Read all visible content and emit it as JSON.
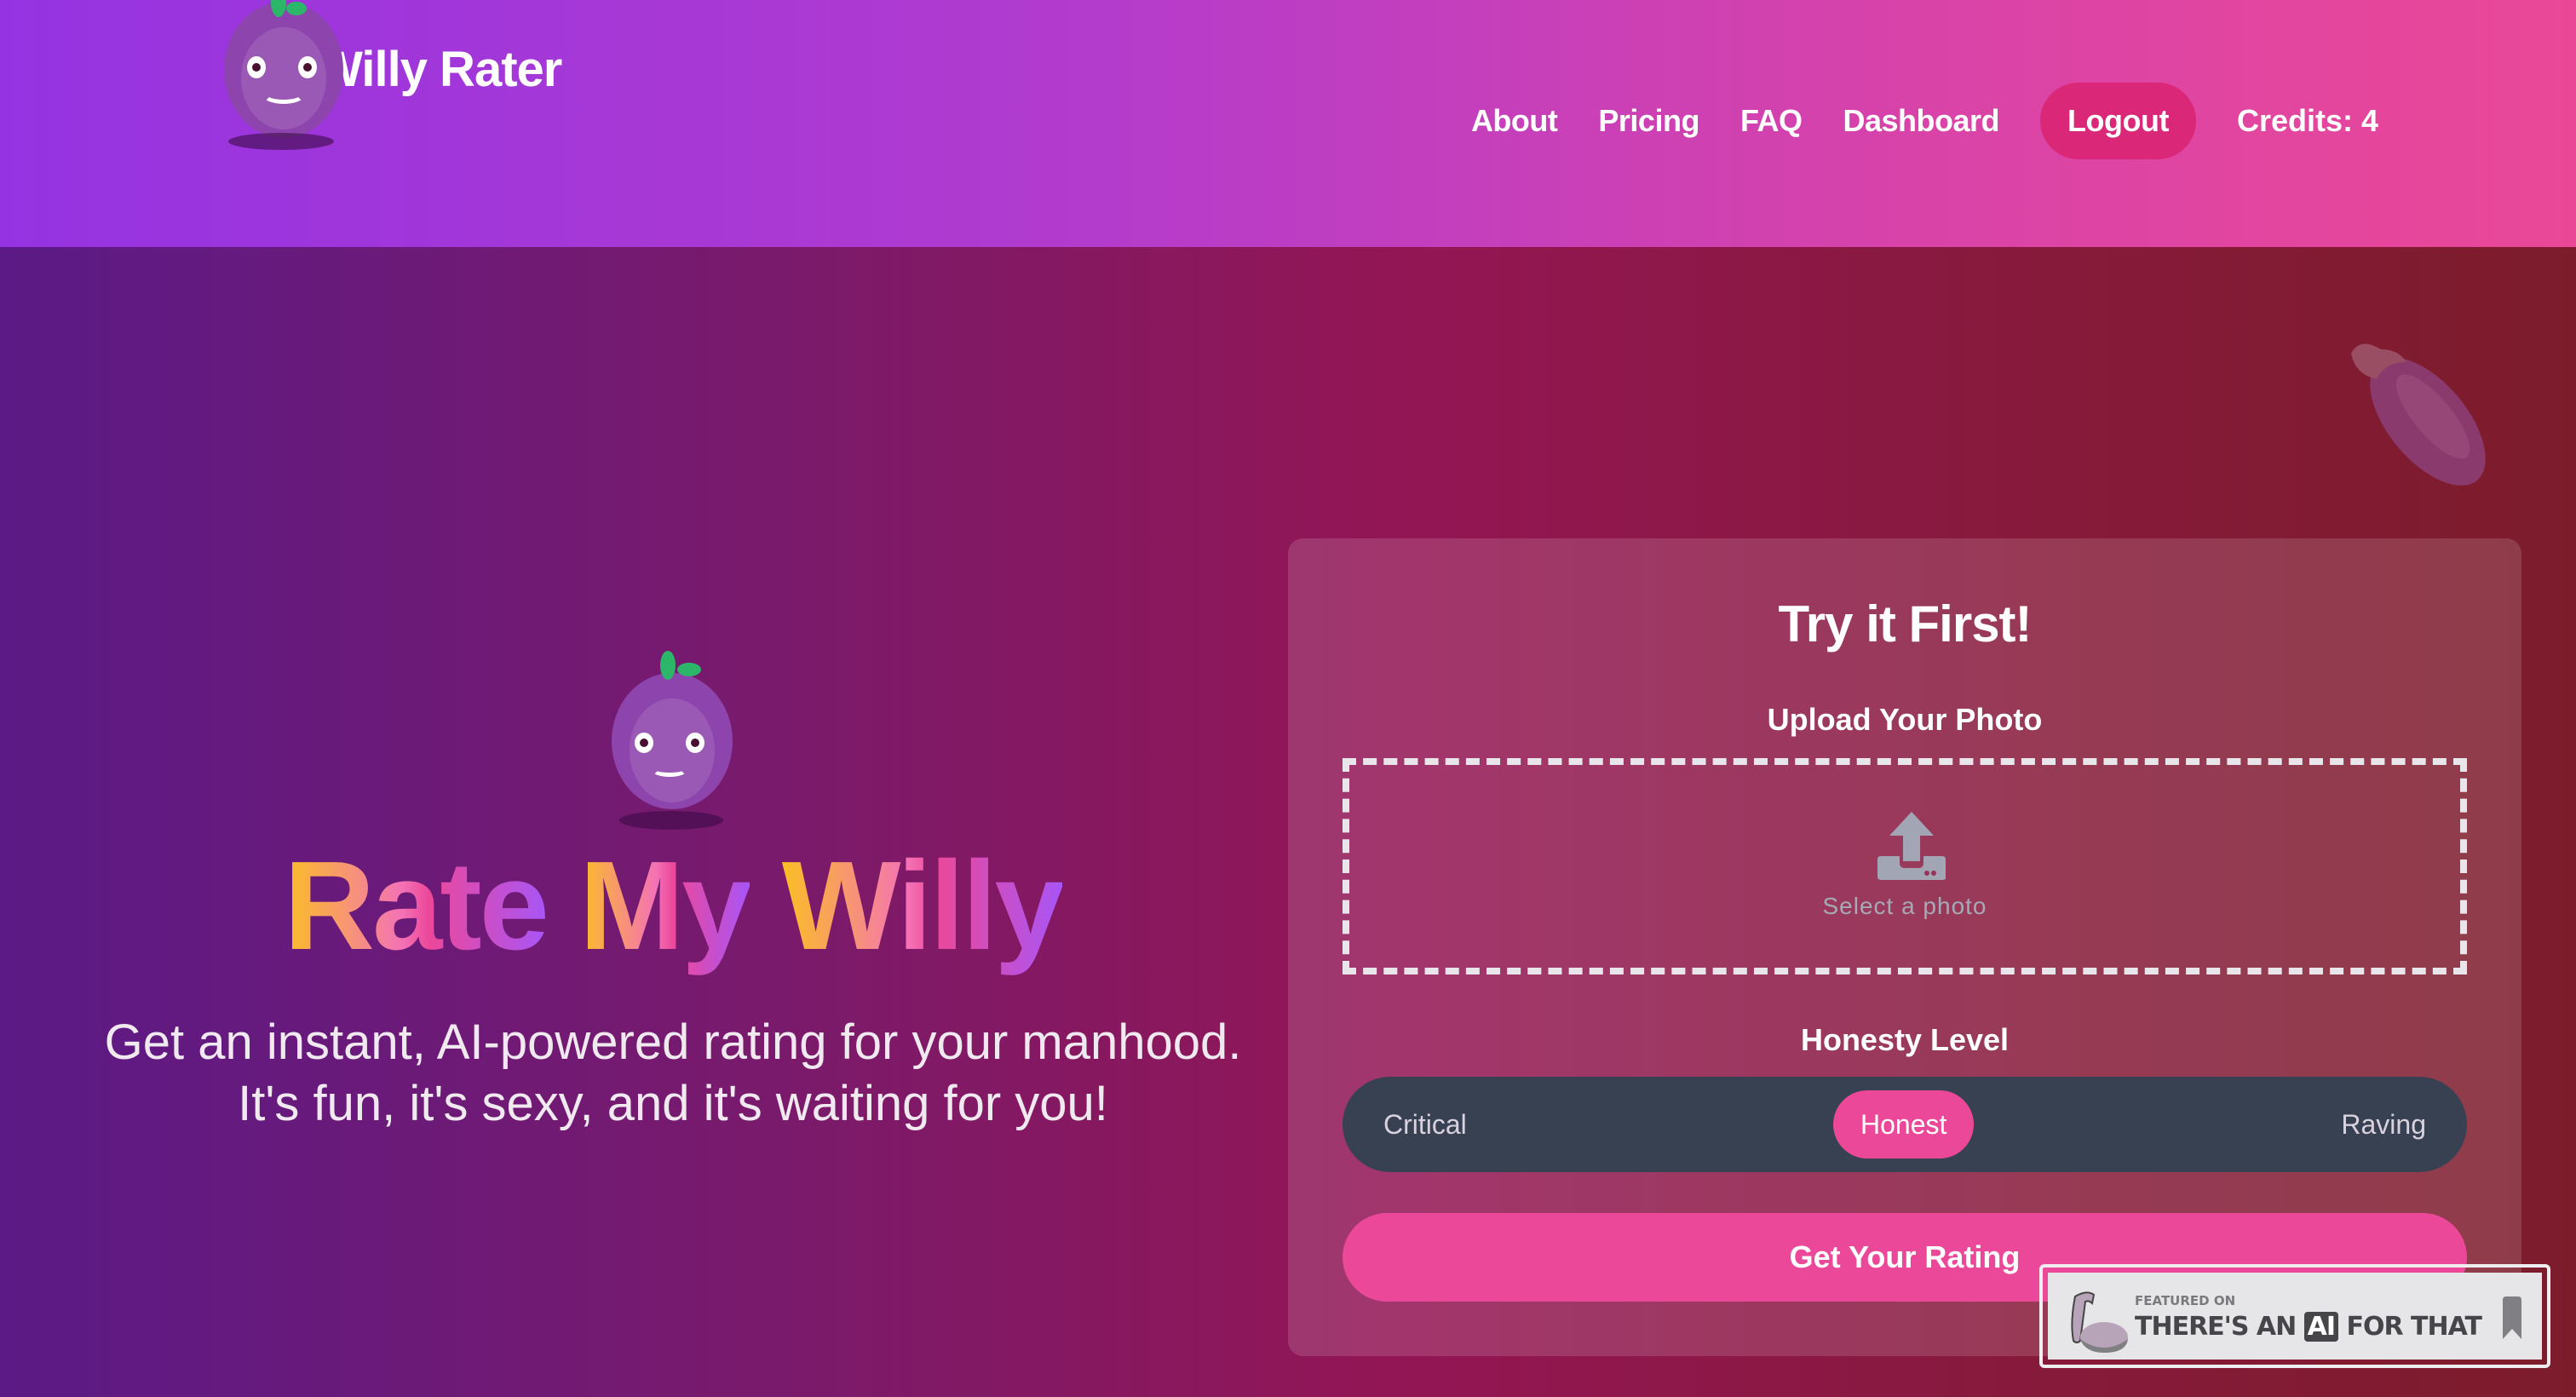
{
  "header": {
    "brand_title": "AI Willy Rater",
    "nav": [
      {
        "label": "About"
      },
      {
        "label": "Pricing"
      },
      {
        "label": "FAQ"
      },
      {
        "label": "Dashboard"
      }
    ],
    "logout_label": "Logout",
    "credits_label": "Credits: 4"
  },
  "hero": {
    "title_words": [
      "Rate",
      "My",
      "Willy"
    ],
    "subtitle": "Get an instant, AI-powered rating for your manhood. It's fun, it's sexy, and it's waiting for you!",
    "decor_emoji": "eggplant-icon"
  },
  "card": {
    "title": "Try it First!",
    "upload_label": "Upload Your Photo",
    "upload_placeholder": "Select a photo",
    "honesty_label": "Honesty Level",
    "honesty_options": [
      "Critical",
      "Honest",
      "Raving"
    ],
    "honesty_selected": "Honest",
    "submit_label": "Get Your Rating"
  },
  "badge": {
    "featured_on": "FEATURED ON",
    "name_before": "THERE'S AN",
    "name_ai": "AI",
    "name_after": "FOR THAT"
  },
  "colors": {
    "accent_pink": "#ec4899",
    "logout_bg": "#db2777",
    "slider_bg": "#384152"
  }
}
